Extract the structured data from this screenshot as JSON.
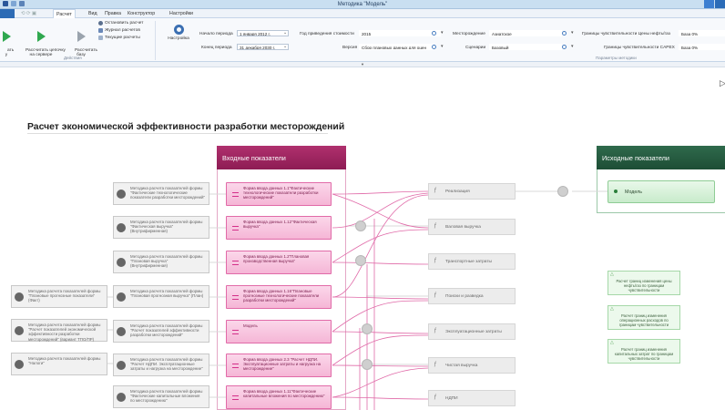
{
  "window": {
    "title": "Методика \"Модель\""
  },
  "tabs": [
    "Расчет",
    "Вид",
    "Правка",
    "Конструктор",
    "Настройки"
  ],
  "ribbon": {
    "run_label": "ать\nу",
    "run_chain_label": "Рассчитать цепочку\nна сервере",
    "run_base_label": "Рассчитать\nбазу",
    "stop_label": "Остановить расчет",
    "log_label": "Журнал расчетов",
    "current_label": "Текущие расчеты",
    "settings_label": "Настройка",
    "group_actions": "Действия",
    "group_params": "Параметры методики",
    "period_start_label": "Начало периода",
    "period_start_value": "1  января  2012 г.",
    "period_end_label": "Конец периода",
    "period_end_value": "31 декабря  2030 г.",
    "year_label": "Год приведения стоимости",
    "year_value": "2015",
    "version_label": "Версия",
    "version_value": "Сбор плановых данных для оцен",
    "field_label": "Месторождение",
    "field_value": "Азиатское",
    "scenario_label": "Сценарии",
    "scenario_value": "Базовый",
    "sens_oil_label": "Границы чувствительности Цены нефть/газ",
    "sens_oil_value": "База 0%",
    "sens_capex_label": "Границы чувствительности CAPEX",
    "sens_capex_value": "База 0%"
  },
  "canvas": {
    "heading": "Расчет экономической эффективности разработки месторождений",
    "input_header": "Входные показатели",
    "source_header": "Исходные показатели",
    "source_item": "Модель",
    "forms": [
      "Форма ввода данных 1.1\"Фактические технологические показатели разработки месторождений\"",
      "Форма ввода данных 1.12\"Фактическая выручка\"",
      "Форма ввода данных 1.2\"Плановая производственная выручка\"",
      "Форма ввода данных 1.16\"Плановые прогнозные технологические показатели разработки месторождений\"",
      "Модель",
      "Форма ввода данных 2.3 \"Расчет НДПИ. Эксплуатационные затраты и нагрузка на месторождение\"",
      "Форма ввода данных 1.11\"Фактические капитальные вложения по месторождению\""
    ],
    "methods": [
      "Методика расчета показателей формы \"Фактические технологические показатели разработки месторождений\"",
      "Методика расчета показателей формы \"Фактическая выручка\" (Внутрифирменная)",
      "Методика расчета показателей формы \"Плановая выручка\" (Внутрифирменная)",
      "Методика расчета показателей формы \"Плановая прогнозная выручка\" (План)",
      "Методика расчета показателей формы \"Расчет показателей эффективности разработки месторождений\"",
      "Методика расчета показателей формы \"Расчет НДПИ. Эксплуатационные затраты и нагрузка на месторождение\"",
      "Методика расчета показателей формы \"Фактические капитальные вложения по месторождению\""
    ],
    "left_methods": [
      "Методика расчета показателей формы \"Плановые прогнозные показатели\" (Факт)",
      "Методика расчета показателей формы \"Расчет показателей экономической эффективности разработки месторождений\" (вариант ТПО/ПР)",
      "Методика расчета показателей формы \"Налоги\""
    ],
    "indicators": [
      "Реализация",
      "Валовая выручка",
      "Транспортные затраты",
      "Поиски и разведка",
      "Эксплуатационные затраты",
      "Чистая выручка",
      "НДПИ"
    ],
    "notes": [
      "Расчет границ изменения цены нефть/газ по границам чувствительности",
      "Расчет границ изменения операционных расходов по границам чувствительности",
      "Расчет границ изменения капитальных затрат по границам чувствительности"
    ]
  },
  "colors": {
    "input_accent": "#9b2460",
    "source_accent": "#245a3f",
    "form_fill": "#f7c3de",
    "ribbon_tab": "#2d6bb5"
  }
}
